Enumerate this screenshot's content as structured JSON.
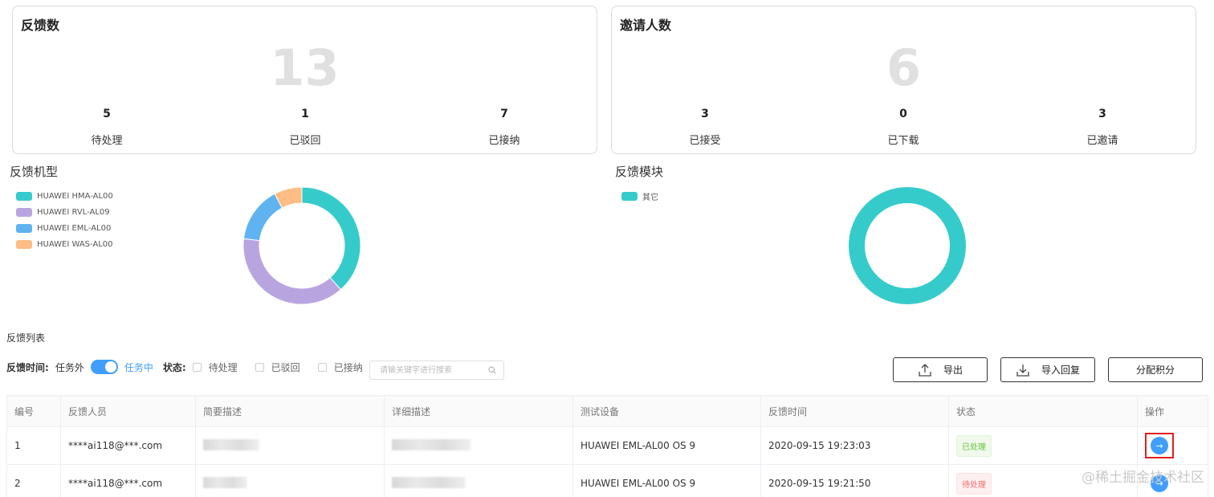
{
  "feedback_card": {
    "title": "反馈数",
    "total": "13",
    "stats": [
      {
        "value": "5",
        "label": "待处理"
      },
      {
        "value": "1",
        "label": "已驳回"
      },
      {
        "value": "7",
        "label": "已接纳"
      }
    ]
  },
  "invite_card": {
    "title": "邀请人数",
    "total": "6",
    "stats": [
      {
        "value": "3",
        "label": "已接受"
      },
      {
        "value": "0",
        "label": "已下载"
      },
      {
        "value": "3",
        "label": "已邀请"
      }
    ]
  },
  "chart_data": [
    {
      "type": "pie",
      "title": "反馈机型",
      "donut": true,
      "legend_position": "left",
      "categories": [
        "HUAWEI HMA-AL00",
        "HUAWEI RVL-AL09",
        "HUAWEI EML-AL00",
        "HUAWEI WAS-AL00"
      ],
      "values": [
        5,
        5,
        2,
        1
      ],
      "colors": [
        "#36cbcb",
        "#b8a5e0",
        "#5fb3f0",
        "#fdbd85"
      ]
    },
    {
      "type": "pie",
      "title": "反馈模块",
      "donut": true,
      "legend_position": "left",
      "categories": [
        "其它"
      ],
      "values": [
        13
      ],
      "colors": [
        "#36cbcb"
      ]
    }
  ],
  "list": {
    "title": "反馈列表",
    "filter": {
      "time_label": "反馈时间:",
      "outside_task": "任务外",
      "in_task": "任务中",
      "status_label": "状态:",
      "status_options": [
        "待处理",
        "已驳回",
        "已接纳"
      ],
      "search_placeholder": "请输关键字进行搜索"
    },
    "buttons": {
      "export": "导出",
      "import_reply": "导入回复",
      "assign_points": "分配积分"
    },
    "columns": [
      "编号",
      "反馈人员",
      "简要描述",
      "详细描述",
      "测试设备",
      "反馈时间",
      "状态",
      "操作"
    ],
    "rows": [
      {
        "id": "1",
        "user": "****ai118@***.com",
        "device": "HUAWEI EML-AL00 OS 9",
        "time": "2020-09-15 19:23:03",
        "status": "已处理"
      },
      {
        "id": "2",
        "user": "****ai118@***.com",
        "device": "HUAWEI EML-AL00 OS 9",
        "time": "2020-09-15 19:21:50",
        "status": "待处理"
      }
    ]
  },
  "watermark": "@稀土掘金技术社区",
  "colors": {
    "accent": "#409eff",
    "teal": "#36cbcb",
    "highlight": "#e02020"
  }
}
